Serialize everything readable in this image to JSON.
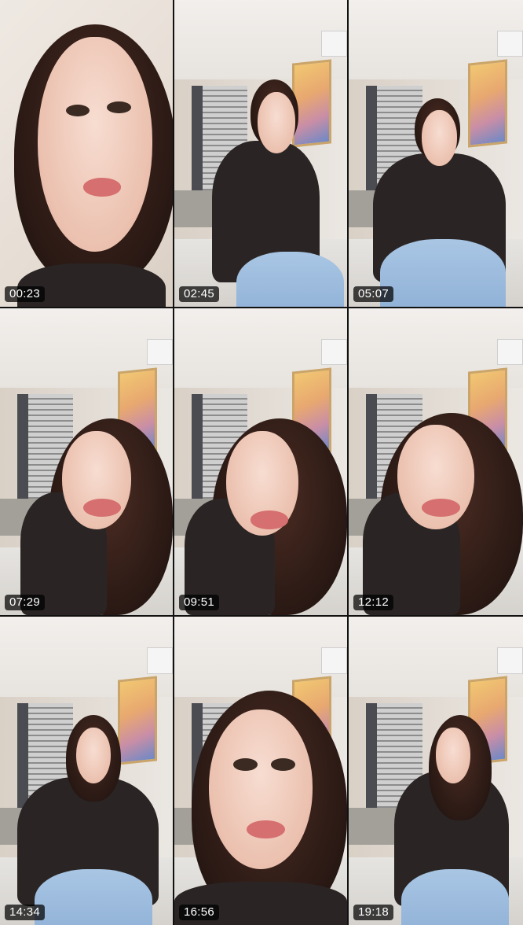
{
  "grid": {
    "tiles": [
      {
        "timestamp": "00:23"
      },
      {
        "timestamp": "02:45"
      },
      {
        "timestamp": "05:07"
      },
      {
        "timestamp": "07:29"
      },
      {
        "timestamp": "09:51"
      },
      {
        "timestamp": "12:12"
      },
      {
        "timestamp": "14:34"
      },
      {
        "timestamp": "16:56"
      },
      {
        "timestamp": "19:18"
      }
    ]
  },
  "colors": {
    "background": "#111111",
    "timestamp_bg": "#000000",
    "timestamp_text": "#ffffff"
  }
}
